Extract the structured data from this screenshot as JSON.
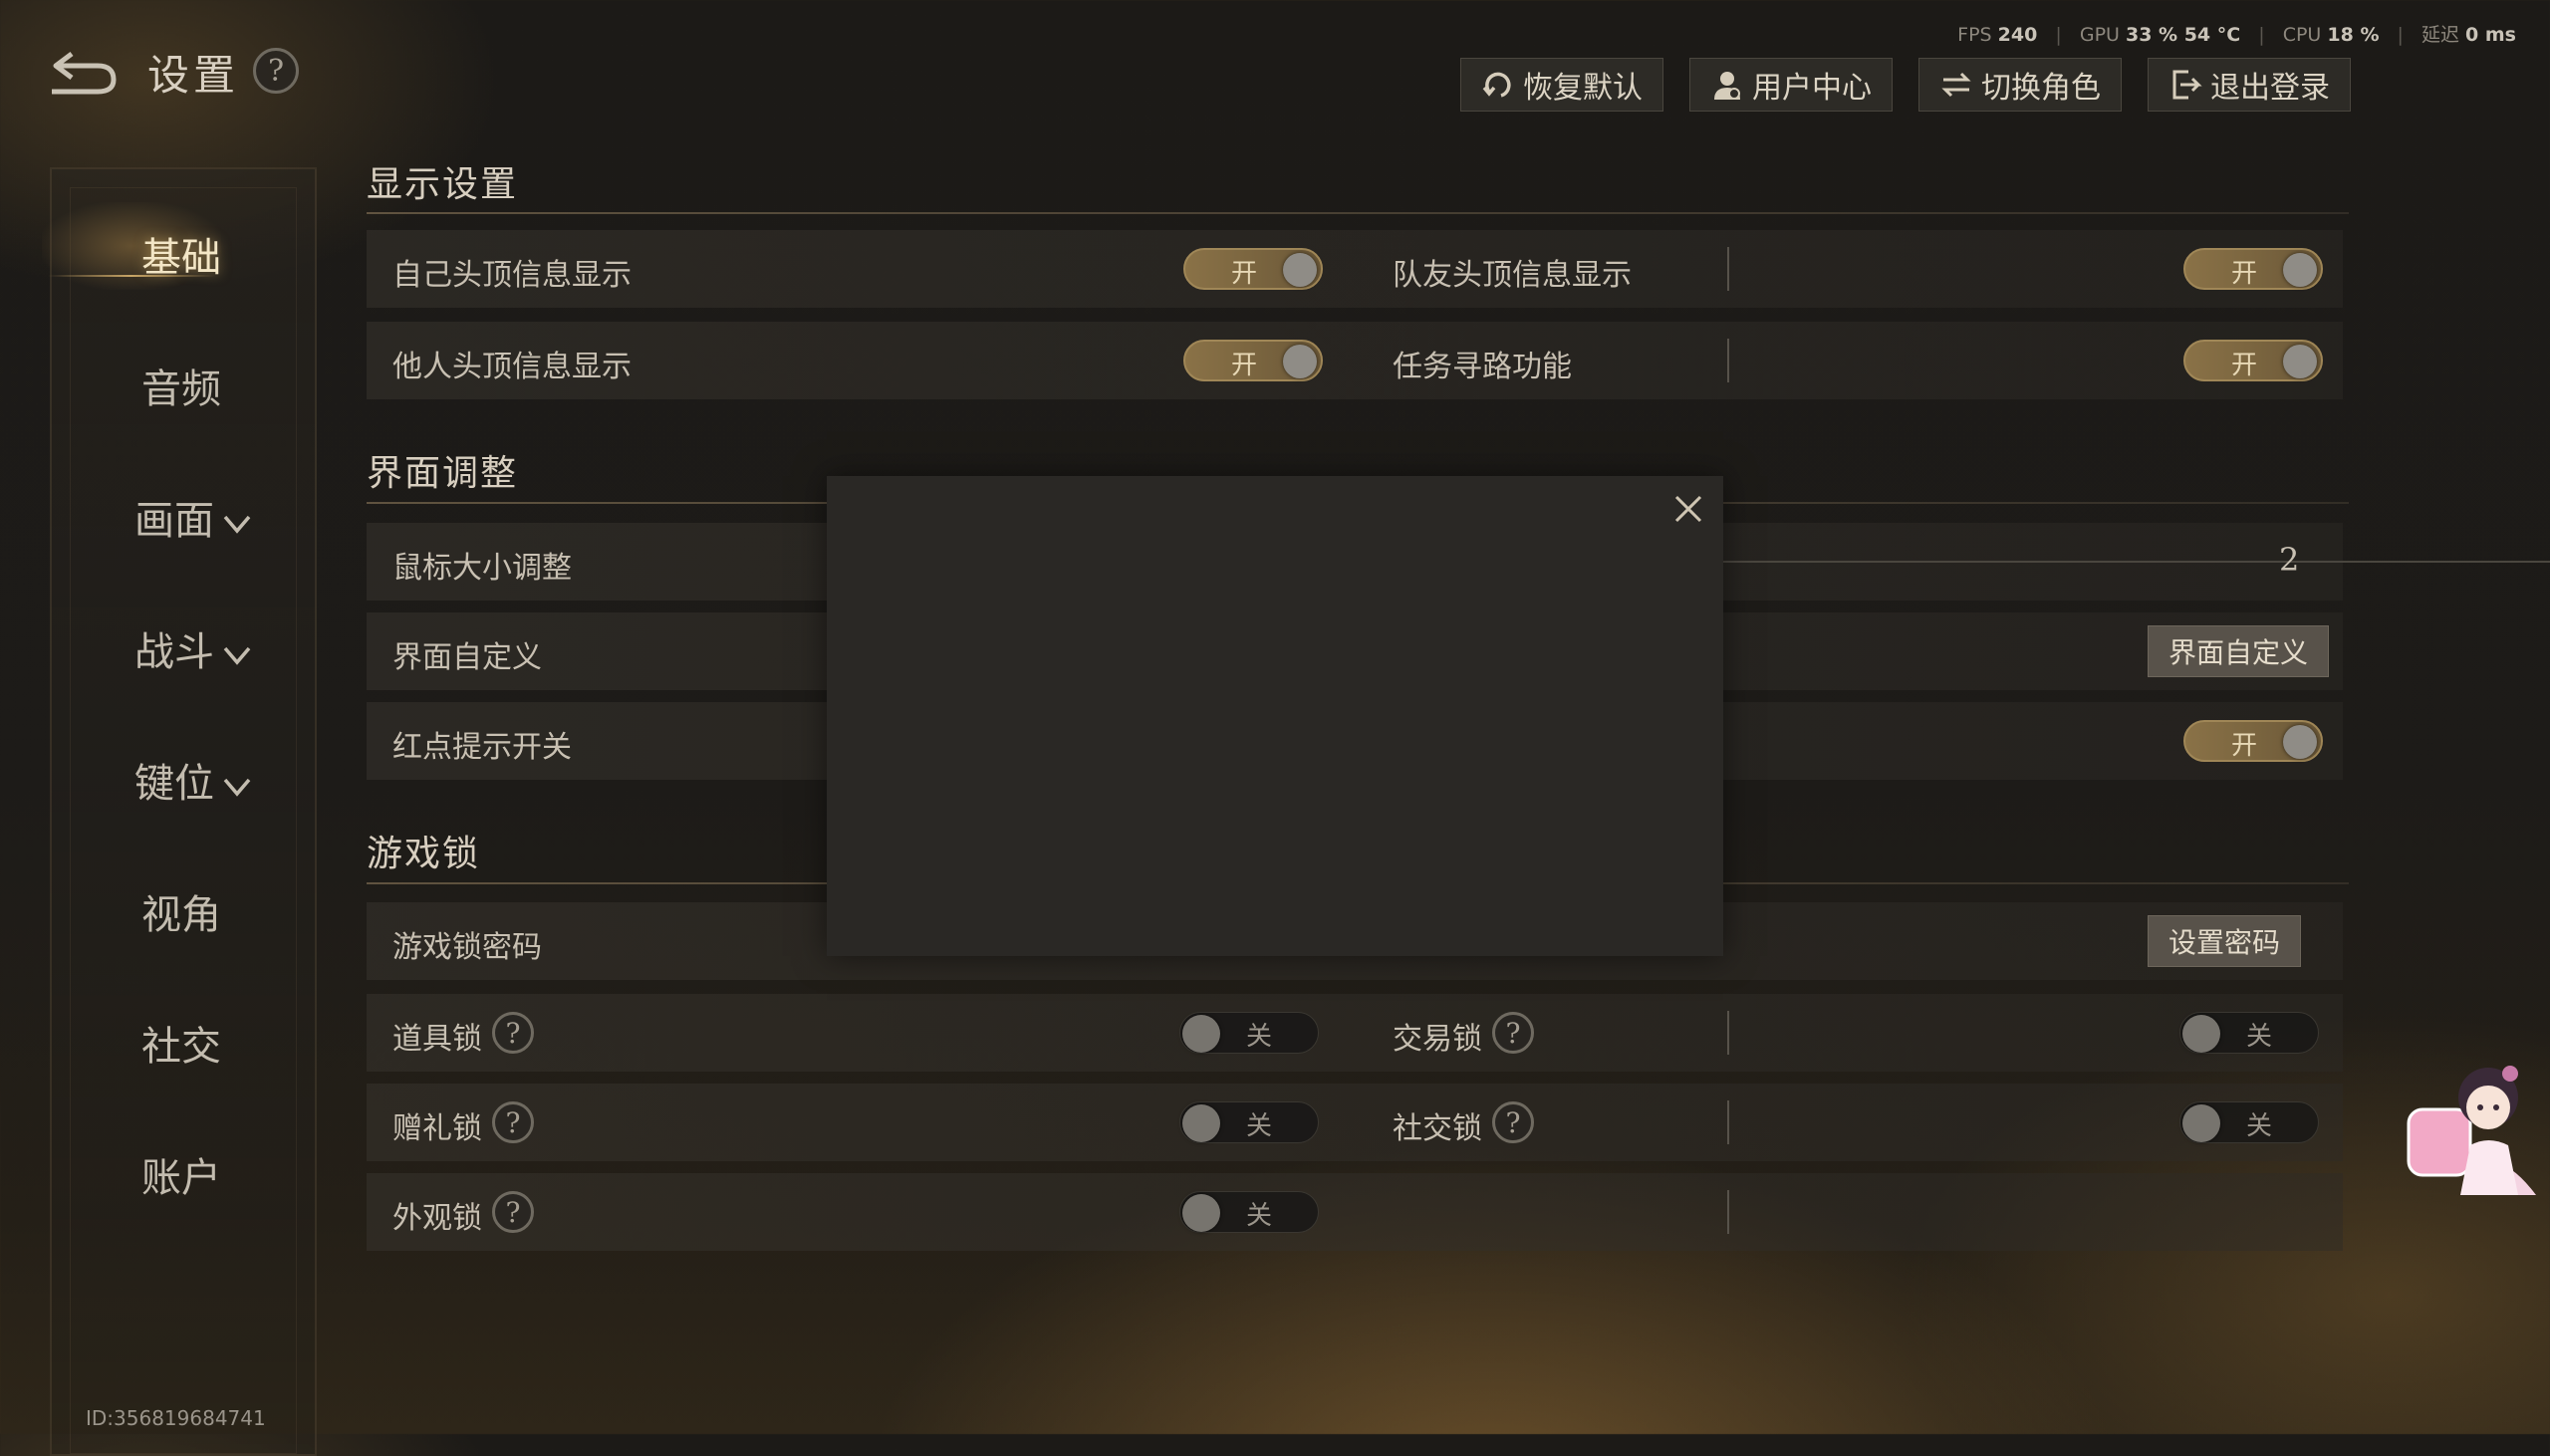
{
  "header": {
    "title": "设置",
    "help_glyph": "?",
    "back_icon": "return-arrow-icon"
  },
  "stats": {
    "fps_label": "FPS",
    "fps_value": "240",
    "gpu_label": "GPU",
    "gpu_value": "33 % 54 °C",
    "cpu_label": "CPU",
    "cpu_value": "18 %",
    "latency_label": "延迟",
    "latency_value": "0 ms",
    "separator": "|"
  },
  "top_buttons": [
    {
      "label": "恢复默认",
      "icon": "reset-icon"
    },
    {
      "label": "用户中心",
      "icon": "user-center-icon"
    },
    {
      "label": "切换角色",
      "icon": "switch-icon"
    },
    {
      "label": "退出登录",
      "icon": "logout-icon"
    }
  ],
  "sidebar": {
    "items": [
      {
        "label": "基础",
        "active": true,
        "expandable": false
      },
      {
        "label": "音频",
        "active": false,
        "expandable": false
      },
      {
        "label": "画面",
        "active": false,
        "expandable": true
      },
      {
        "label": "战斗",
        "active": false,
        "expandable": true
      },
      {
        "label": "键位",
        "active": false,
        "expandable": true
      },
      {
        "label": "视角",
        "active": false,
        "expandable": false
      },
      {
        "label": "社交",
        "active": false,
        "expandable": false
      },
      {
        "label": "账户",
        "active": false,
        "expandable": false
      }
    ]
  },
  "user_id": "ID:356819684741",
  "sections": {
    "display": {
      "title": "显示设置",
      "rows": [
        {
          "left": {
            "label": "自己头顶信息显示",
            "state": "开"
          },
          "right": {
            "label": "队友头顶信息显示",
            "state": "开"
          }
        },
        {
          "left": {
            "label": "他人头顶信息显示",
            "state": "开"
          },
          "right": {
            "label": "任务寻路功能",
            "state": "开"
          }
        }
      ]
    },
    "interface": {
      "title": "界面调整",
      "cursor": {
        "label": "鼠标大小调整",
        "value": "2"
      },
      "customize": {
        "label": "界面自定义",
        "button": "界面自定义"
      },
      "red_dot": {
        "label": "红点提示开关",
        "state": "开"
      }
    },
    "lock": {
      "title": "游戏锁",
      "password": {
        "label": "游戏锁密码",
        "button": "设置密码"
      },
      "locks": [
        {
          "label": "道具锁",
          "state": "关"
        },
        {
          "label": "交易锁",
          "state": "关"
        },
        {
          "label": "赠礼锁",
          "state": "关"
        },
        {
          "label": "社交锁",
          "state": "关"
        },
        {
          "label": "外观锁",
          "state": "关"
        }
      ]
    }
  },
  "colors": {
    "toggle_on": "#8a7247",
    "accent_gold": "#c9a667",
    "modal_bg": "#2a2825"
  }
}
